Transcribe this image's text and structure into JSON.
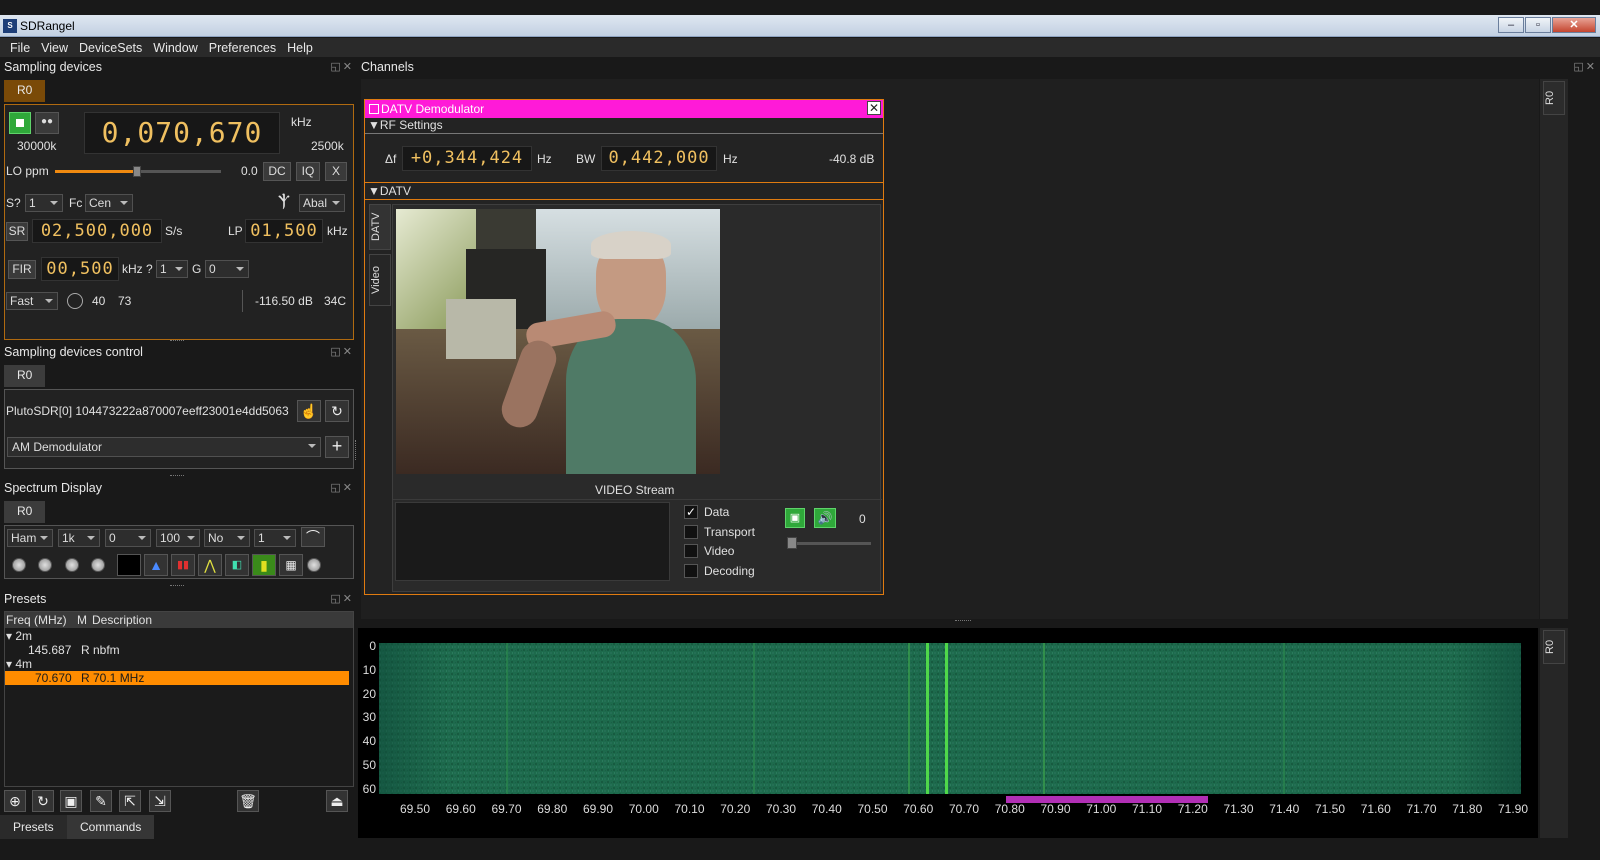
{
  "window": {
    "title": "SDRangel",
    "app_icon": "S"
  },
  "menu": [
    "File",
    "View",
    "DeviceSets",
    "Window",
    "Preferences",
    "Help"
  ],
  "sampling_devices": {
    "title": "Sampling devices",
    "tab": "R0",
    "frequency": "0,070,670",
    "freq_unit": "kHz",
    "left_val": "30000k",
    "right_val": "2500k",
    "lo_label": "LO ppm",
    "lo_value": "0.0",
    "dc": "DC",
    "iq": "IQ",
    "x": "X",
    "s_label": "S?",
    "s_value": "1",
    "fc_label": "Fc",
    "fc_value": "Cen",
    "antenna_value": "Abal",
    "sr_label": "SR",
    "sr_value": "02,500,000",
    "sr_unit": "S/s",
    "lp_label": "LP",
    "lp_value": "01,500",
    "lp_unit": "kHz",
    "fir_label": "FIR",
    "fir_value": "00,500",
    "fir_unit": "kHz",
    "q_label": "?",
    "q_value": "1",
    "g_label": "G",
    "g_value": "0",
    "gain_mode": "Fast",
    "gain_a": "40",
    "gain_b": "73",
    "power": "-116.50 dB",
    "temp": "34C"
  },
  "devices_control": {
    "title": "Sampling devices control",
    "tab": "R0",
    "device": "PlutoSDR[0] 104473222a870007eeff23001e4dd5063",
    "channel_select": "AM Demodulator"
  },
  "spectrum_display": {
    "title": "Spectrum Display",
    "tab": "R0",
    "combos": [
      "Ham",
      "1k",
      "0",
      "100",
      "No",
      "1"
    ]
  },
  "presets": {
    "title": "Presets",
    "headers": [
      "Freq (MHz)",
      "M",
      "Description"
    ],
    "group1": "2m",
    "row1": {
      "freq": "145.687",
      "m": "R",
      "desc": "nbfm"
    },
    "group2": "4m",
    "row2": {
      "freq": "70.670",
      "m": "R",
      "desc": "70.1 MHz"
    },
    "tabs": [
      "Presets",
      "Commands"
    ]
  },
  "channels": {
    "title": "Channels",
    "side_tab": "R0",
    "datv": {
      "title": "DATV Demodulator",
      "rf_section": "RF Settings",
      "delta_label": "Δf",
      "delta_value": "+0,344,424",
      "delta_unit": "Hz",
      "bw_label": "BW",
      "bw_value": "0,442,000",
      "bw_unit": "Hz",
      "power": "-40.8 dB",
      "datv_section": "DATV",
      "side_tabs": [
        "DATV",
        "Video"
      ],
      "video_label": "VIDEO Stream",
      "checks": [
        {
          "label": "Data",
          "checked": true
        },
        {
          "label": "Transport",
          "checked": false
        },
        {
          "label": "Video",
          "checked": false
        },
        {
          "label": "Decoding",
          "checked": false
        }
      ],
      "counter": "0"
    }
  },
  "waterfall": {
    "side_tab": "R0",
    "y_ticks": [
      "0",
      "10",
      "20",
      "30",
      "40",
      "50",
      "60"
    ],
    "x_ticks": [
      "69.50",
      "69.60",
      "69.70",
      "69.80",
      "69.90",
      "70.00",
      "70.10",
      "70.20",
      "70.30",
      "70.40",
      "70.50",
      "70.60",
      "70.70",
      "70.80",
      "70.90",
      "71.00",
      "71.10",
      "71.20",
      "71.30",
      "71.40",
      "71.50",
      "71.60",
      "71.70",
      "71.80",
      "71.90"
    ],
    "colors": {
      "base": "#1e6b4e",
      "line": "#4fd84a",
      "marker": "#b12fb5"
    }
  }
}
